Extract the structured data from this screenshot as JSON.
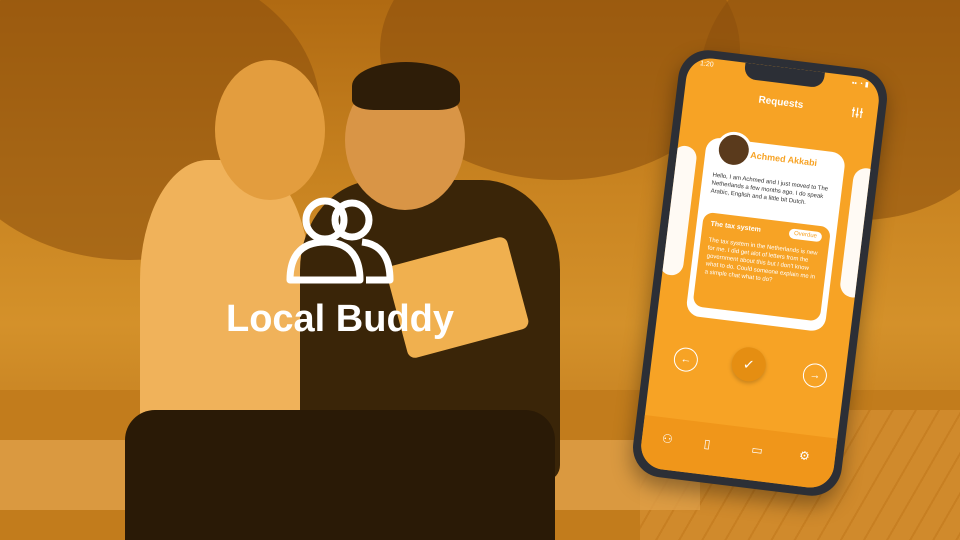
{
  "brand": {
    "title": "Local Buddy",
    "accent_color": "#f7a325",
    "logo_icon": "users-icon"
  },
  "phone": {
    "status_time": "1:20",
    "screen_title": "Requests",
    "filter_icon": "filter-icon",
    "card": {
      "name": "Achmed Akkabi",
      "bio": "Hello, I am Achmed and I just moved to The Netherlands a few months ago. I do speak Arabic, English and a little bit Dutch.",
      "request": {
        "title": "The tax system",
        "badge": "Overdue",
        "text": "The tax system in the Netherlands is new for me. I did get alot of letters from the government about this but I don't know what to do. Could someone explain me in a simple chat what to do?"
      }
    },
    "actions": {
      "prev_icon": "arrow-left-icon",
      "accept_icon": "check-icon",
      "next_icon": "arrow-right-icon"
    },
    "tabs": [
      "buddies-tab",
      "documents-tab",
      "chat-tab",
      "settings-tab"
    ]
  }
}
